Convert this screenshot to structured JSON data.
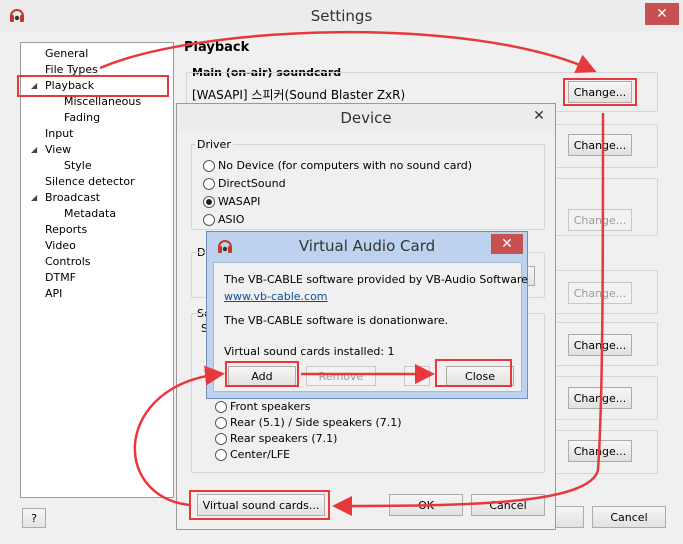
{
  "settings": {
    "title": "Settings",
    "close_glyph": "✕",
    "tree": [
      {
        "label": "General"
      },
      {
        "label": "File Types"
      },
      {
        "label": "Playback"
      },
      {
        "label": "Miscellaneous"
      },
      {
        "label": "Fading"
      },
      {
        "label": "Input"
      },
      {
        "label": "View"
      },
      {
        "label": "Style"
      },
      {
        "label": "Silence detector"
      },
      {
        "label": "Broadcast"
      },
      {
        "label": "Metadata"
      },
      {
        "label": "Reports"
      },
      {
        "label": "Video"
      },
      {
        "label": "Controls"
      },
      {
        "label": "DTMF"
      },
      {
        "label": "API"
      }
    ],
    "help_label": "?",
    "section_title": "Playback",
    "main_soundcard_label": "Main (on-air) soundcard",
    "main_soundcard_value": "[WASAPI] 스피커(Sound Blaster ZxR)",
    "change_label": "Change...",
    "cancel_label": "Cancel"
  },
  "device": {
    "title": "Device",
    "close_glyph": "✕",
    "driver_label": "Driver",
    "drivers": [
      {
        "label": "No Device (for computers with no sound card)",
        "selected": false
      },
      {
        "label": "DirectSound",
        "selected": false
      },
      {
        "label": "WASAPI",
        "selected": true
      },
      {
        "label": "ASIO",
        "selected": false
      }
    ],
    "partial_label_de": "De",
    "partial_label_se": "Se",
    "partial_label_s": "S",
    "speakers": [
      {
        "label": "Front speakers"
      },
      {
        "label": "Rear (5.1) / Side speakers (7.1)"
      },
      {
        "label": "Rear speakers (7.1)"
      },
      {
        "label": "Center/LFE"
      }
    ],
    "virtual_cards_label": "Virtual sound cards...",
    "ok_label": "OK",
    "cancel_label": "Cancel"
  },
  "vac": {
    "title": "Virtual Audio Card",
    "close_glyph": "✕",
    "line1": "The VB-CABLE software provided by VB-Audio Software",
    "link": "www.vb-cable.com",
    "line2": "The VB-CABLE software is donationware.",
    "installed": "Virtual sound cards installed: 1",
    "add_label": "Add",
    "remove_label": "Remove",
    "help_label": "?",
    "close_label": "Close"
  },
  "colors": {
    "highlight": "#e8383d",
    "title_close_bg": "#c75050",
    "vac_title_bg": "#bcd2ee",
    "link": "#0b4d9a"
  }
}
